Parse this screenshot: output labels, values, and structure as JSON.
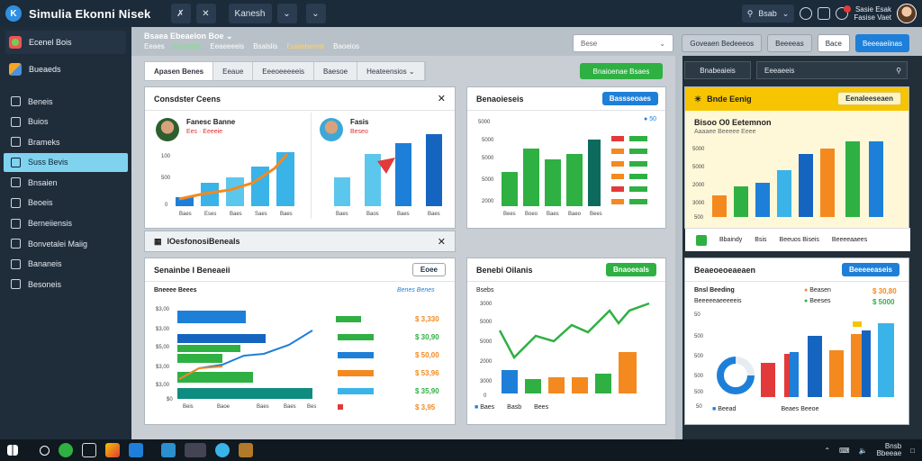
{
  "topbar": {
    "title": "Simulia Ekonni Nisek",
    "btn1": "✗",
    "btn2": "✕",
    "btn3": "Kanesh",
    "btn4": "⌄",
    "btn5": "⌄",
    "search_label": "Bsab",
    "user_line1": "Sasie Esak",
    "user_line2": "Fasise Vaet"
  },
  "sidebar": {
    "user_item": "Ecenel Bois",
    "second_item": "Bueaeds",
    "items": [
      "Beneis",
      "Buios",
      "Brameks",
      "Suss Bevis",
      "Bnsaien",
      "Beoeis",
      "Berneiiensis",
      "Bonvetalei Maiig",
      "Bananeis",
      "Besoneis"
    ],
    "active_index": 3
  },
  "subheader": {
    "title": "Bsaea Ebeaeion Boe",
    "links": [
      "Eeaes",
      "Baloeeis",
      "Eeaeeeeis",
      "Bsalslis",
      "Euiaebemis",
      "Baoeios"
    ],
    "select_placeholder": "Bese",
    "buttons": [
      "Goveaen Bedeeeos",
      "Beeeeas",
      "Bace",
      "Beeeaeiinas"
    ]
  },
  "tabs": [
    "Apasen Benes",
    "Eeaue",
    "Eeeoeeeeeis",
    "Baesoe",
    "Heateensios"
  ],
  "tab_action": "Bnaioenae Bsaes",
  "card1": {
    "title": "Consdster Ceens",
    "person1_name": "Fanesc Banne",
    "person1_sub": "Ees · Eeeeie",
    "person2_name": "Fasis",
    "person2_sub": "Beseo",
    "yticks": [
      "100",
      "500",
      "0"
    ],
    "xticks1": [
      "Baes",
      "Eses",
      "Baes",
      "Saes",
      "Baes"
    ],
    "xticks2": [
      "Baes",
      "Baos",
      "Baes",
      "Baes"
    ]
  },
  "bar_strip": {
    "title": "IOesfonosiBeneals"
  },
  "card2": {
    "title": "Benaoieseis",
    "button": "Bassseoaes",
    "yticks": [
      "5000",
      "5000",
      "5000",
      "5000",
      "2000"
    ],
    "xticks": [
      "Bees",
      "Boeo",
      "Baes",
      "Baeo",
      "Bees"
    ],
    "legend_value": "50"
  },
  "card3": {
    "header": "Bnde Eenig",
    "button": "Eenaleeseaen",
    "subtitle": "Bisoo O0 Eetemnon",
    "meta": "Aaaaee Beeeee Eeee",
    "footer": [
      "Bbaindy",
      "Bsis",
      "Beeuos Biseis",
      "Beeeeaaees"
    ],
    "yticks": [
      "5000",
      "5000",
      "2000",
      "3000",
      "500"
    ]
  },
  "card4": {
    "title": "Senainbe I Beneaeii",
    "button": "Eoee",
    "left_label": "Bneeee Beees",
    "right_label": "Benes Benes",
    "yticks": [
      "$3,00",
      "$3,00",
      "$5,00",
      "$3,00",
      "$3,00",
      "$0"
    ],
    "xticks": [
      "Beis",
      "Baoe",
      "Baes",
      "Baes",
      "Bes"
    ],
    "values": [
      "$ 3,330",
      "$ 30,90",
      "$ 50,00",
      "$ 53,96",
      "$ 35,90",
      "$ 3,95"
    ],
    "row_labels": [
      "Biees",
      "Seenee",
      "Beees",
      "Bnseee",
      "Beseee",
      "Boee"
    ]
  },
  "card5": {
    "title": "Benebi Oilanis",
    "button": "Bnaoeeals",
    "axis_label": "Bsebs",
    "yticks": [
      "3000",
      "5000",
      "5000",
      "2000",
      "3000",
      "0"
    ],
    "legend": [
      "Baes",
      "Basb",
      "Bees"
    ]
  },
  "card6": {
    "title": "Beaeoeoeaeaen",
    "button": "Beeeeeaseis",
    "row1_label": "Bnsl Beeding",
    "row1_mid": "Beasen",
    "row1_val": "$ 30,80",
    "row2_label": "Beeeeeaeeeeeis",
    "row2_mid": "Beeses",
    "row2_val": "$ 5000",
    "yticks": [
      "50",
      "500",
      "500",
      "500",
      "500",
      "50"
    ],
    "legend": [
      "Beead",
      "Beaes Beeoe"
    ]
  },
  "taskbar": {
    "time": "Bnsb",
    "date": "Bbeeae"
  },
  "colors": {
    "accent_blue": "#1e7fd8",
    "accent_green": "#2fb043",
    "accent_orange": "#f4891f",
    "accent_yellow": "#f6c400",
    "dark_bg": "#1c2b3a"
  }
}
